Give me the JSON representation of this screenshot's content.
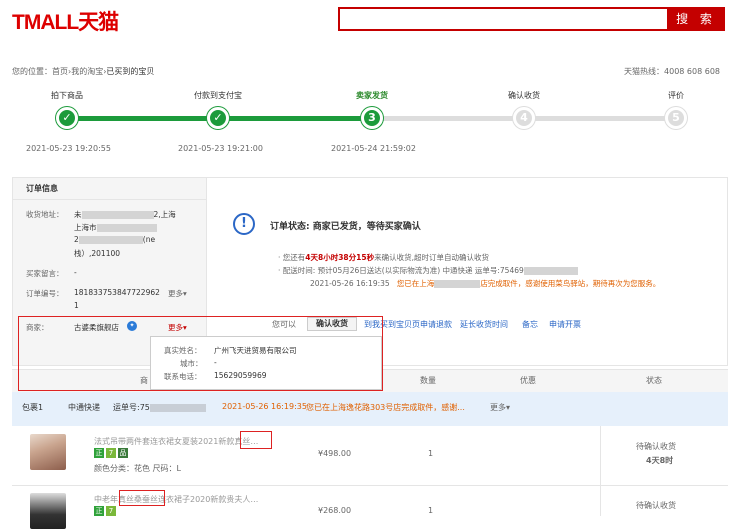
{
  "header": {
    "logo": "TMALL天猫",
    "search_placeholder": "",
    "search_button": "搜 索"
  },
  "breadcrumb": {
    "prefix": "您的位置：",
    "home": "首页",
    "sep1": "›",
    "my_orders": "我的淘宝",
    "sep2": "›",
    "current": "已买到的宝贝"
  },
  "hotline": "天猫热线：4008 608 608",
  "steps": [
    {
      "label": "拍下商品",
      "number": "✓",
      "time": "2021-05-23 19:20:55"
    },
    {
      "label": "付款到支付宝",
      "number": "✓",
      "time": "2021-05-23 19:21:00"
    },
    {
      "label": "卖家发货",
      "number": "3",
      "time": "2021-05-24 21:59:02"
    },
    {
      "label": "确认收货",
      "number": "4",
      "time": ""
    },
    {
      "label": "评价",
      "number": "5",
      "time": ""
    }
  ],
  "order_info": {
    "title": "订单信息",
    "address_label": "收货地址：",
    "address_l1a": "未",
    "address_l1b": "2,上海",
    "address_l2": "上海市",
    "address_l3a": "2",
    "address_l3b": "(ne",
    "address_l4": "栈）,201100",
    "message_label": "买家留言：",
    "message_value": "-",
    "order_no_label": "订单编号：",
    "order_no": "1818337538477229621",
    "order_no_line1": "181833753847722962",
    "order_no_line2": "1",
    "more": "更多",
    "merchant_label": "商家：",
    "merchant_name": "古婆柔旗舰店",
    "merchant_more": "更多"
  },
  "status": {
    "title": "订单状态: 商家已发货，等待买家确认",
    "line1_pre": "· 您还有",
    "line1_time": "4天8小时38分15秒",
    "line1_post": "来确认收货,超时订单自动确认收货",
    "line2": "· 配送时间:  预计05月26日送达(以实际物流为准)   中通快递   运单号:75469",
    "line3_time": "2021-05-26 16:19:35",
    "line3_msg_a": "您已在上海",
    "line3_msg_b": "店完成取件，感谢使用菜鸟驿站，期待再次为您服务。"
  },
  "actions": {
    "prefix": "您可以",
    "confirm": "确认收货",
    "remind": "到我买到宝贝页申请退款",
    "extend": "延长收货时间",
    "note": "备忘",
    "invoice": "申请开票"
  },
  "popup": {
    "name_label": "真实姓名：",
    "name_value": "广州飞天进贸易有限公司",
    "city_label": "城市：",
    "city_value": "-",
    "phone_label": "联系电话：",
    "phone_value": "15629059969"
  },
  "table_headers": {
    "product": "商",
    "qty": "数量",
    "discount": "优惠",
    "status": "状态"
  },
  "package": {
    "label": "包裹1",
    "courier": "中通快递",
    "tracking_prefix": "运单号:75",
    "time": "2021-05-26 16:19:35",
    "msg": "您已在上海逸花路303号店完成取件，感谢...",
    "more": "更多"
  },
  "items": [
    {
      "name_a": "法式吊带两件套连衣裙女夏装2021新款",
      "name_b": "真丝…",
      "attr": "颜色分类：花色  尺码：L",
      "price": "¥498.00",
      "qty": "1",
      "status": "待确认收货",
      "countdown": "4天8时",
      "tags": [
        "正",
        "7",
        "品"
      ]
    },
    {
      "name_a": "中老年",
      "name_b": "真丝桑蚕丝",
      "name_c": "连衣裙子2020新款贵夫人…",
      "price": "¥268.00",
      "qty": "1",
      "status": "待确认收货",
      "tags": [
        "正",
        "7"
      ]
    }
  ],
  "colors": {
    "brand": "#c40000",
    "green": "#1c9b3b",
    "link": "#2b67c6",
    "orange": "#e06000"
  }
}
